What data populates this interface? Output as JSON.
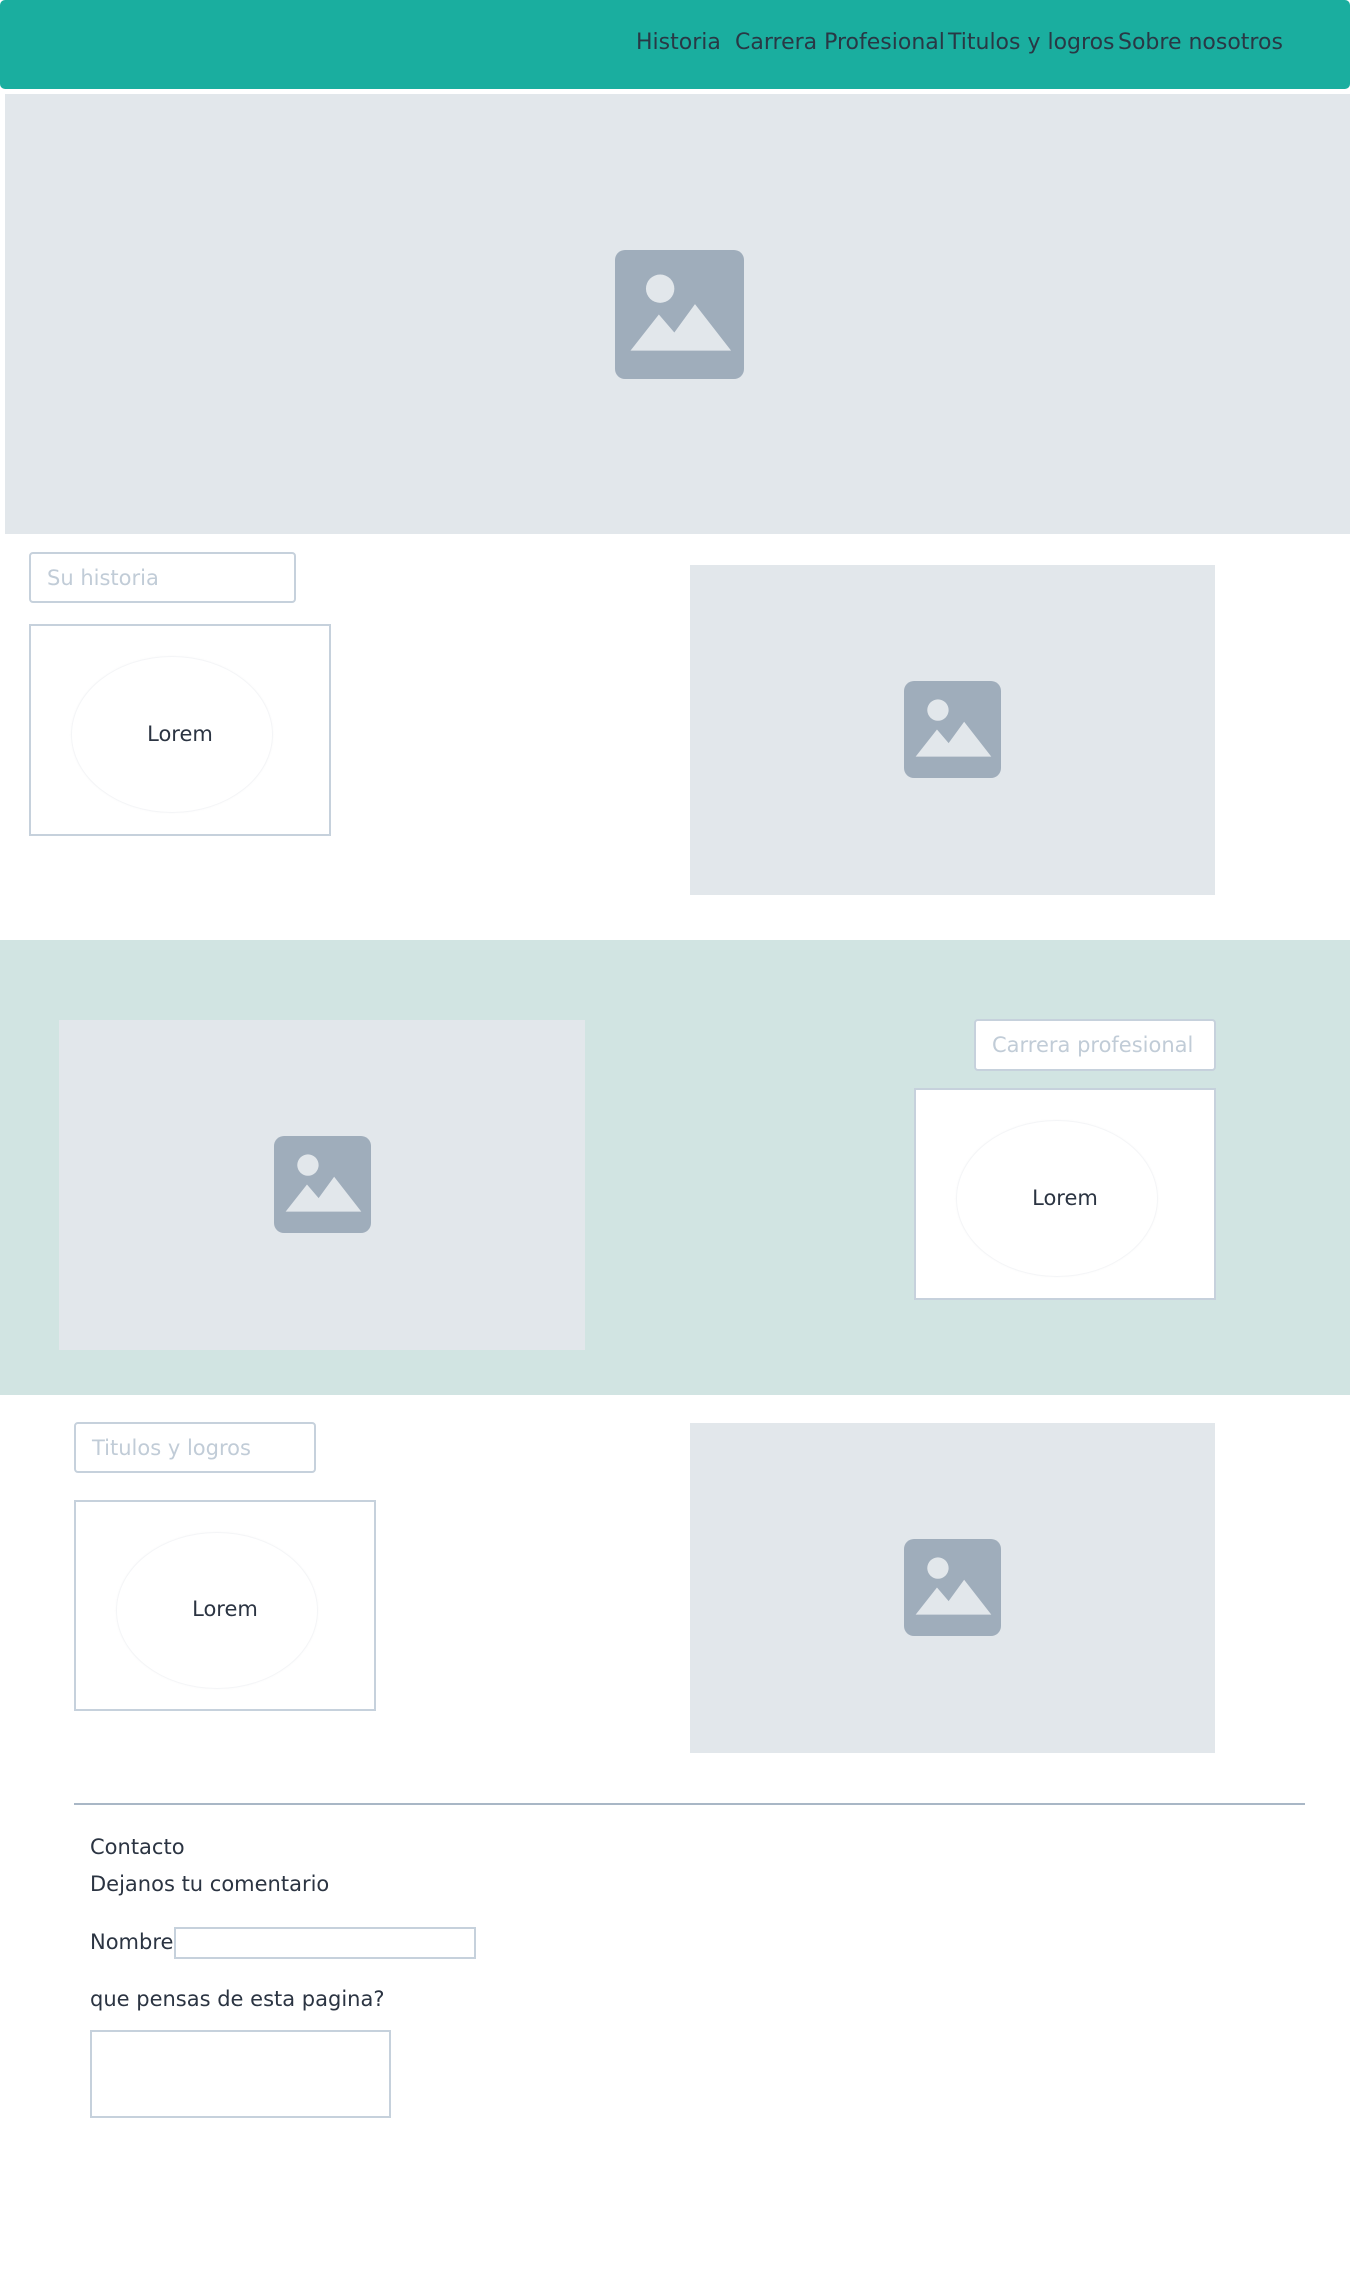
{
  "nav": {
    "items": [
      {
        "label": "Historia"
      },
      {
        "label": "Carrera Profesional"
      },
      {
        "label": "Titulos y logros"
      },
      {
        "label": "Sobre nosotros"
      }
    ]
  },
  "sections": {
    "historia": {
      "label": "Su historia",
      "card_text": "Lorem"
    },
    "carrera": {
      "label": "Carrera profesional",
      "card_text": "Lorem"
    },
    "titulos": {
      "label": "Titulos y logros",
      "card_text": "Lorem"
    }
  },
  "contact": {
    "title": "Contacto",
    "subtitle": "Dejanos tu comentario",
    "name_label": "Nombre",
    "name_value": "",
    "question_label": "que pensas de esta pagina?",
    "comment_value": ""
  },
  "icons": {
    "image_placeholder": "image-placeholder-icon"
  },
  "colors": {
    "navbar": "#1aae9f",
    "band": "#d1e4e2",
    "placeholder_bg": "#e2e7eb",
    "placeholder_icon": "#9fadbb",
    "border": "#c6d1dc"
  }
}
